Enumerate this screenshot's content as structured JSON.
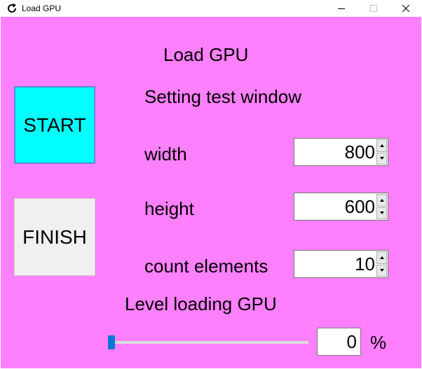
{
  "window": {
    "title": "Load GPU",
    "icon": "reload-icon",
    "controls": {
      "minimize_icon": "minimize-icon",
      "maximize_icon": "maximize-icon",
      "close_icon": "close-icon"
    }
  },
  "main": {
    "heading": "Load GPU",
    "setting_label": "Setting test window",
    "start_label": "START",
    "finish_label": "FINISH",
    "fields": {
      "width": {
        "label": "width",
        "value": "800"
      },
      "height": {
        "label": "height",
        "value": "600"
      },
      "count": {
        "label": "count elements",
        "value": "10"
      }
    },
    "level": {
      "label": "Level loading GPU",
      "value": "0",
      "fraction": 0,
      "unit": "%"
    }
  },
  "colors": {
    "background": "#ff80ff",
    "start_button": "#00ffff",
    "finish_button": "#f0f0f0",
    "slider_thumb": "#0078d7"
  }
}
